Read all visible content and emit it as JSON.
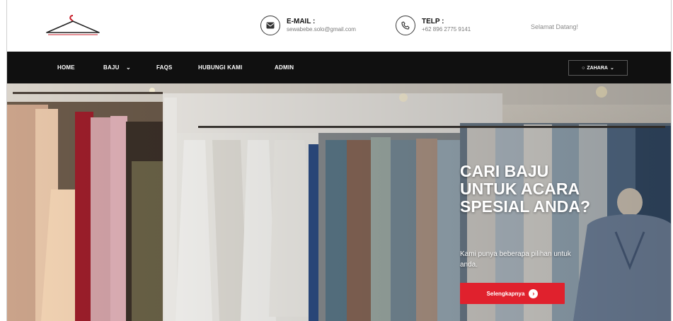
{
  "header": {
    "email_label": "E-MAIL :",
    "email_value": "sewabebe.solo@gmail.com",
    "phone_label": "TELP :",
    "phone_value": "+62 896 2775 9141",
    "welcome": "Selamat Datang!"
  },
  "nav": {
    "items": [
      "HOME",
      "BAJU",
      "FAQS",
      "HUBUNGI KAMI",
      "ADMIN"
    ],
    "user": "ZAHARA"
  },
  "hero": {
    "title_lines": [
      "CARI BAJU",
      "UNTUK ACARA",
      "SPESIAL ANDA?"
    ],
    "subtitle": "Kami punya beberapa pilihan untuk anda.",
    "button": "Selengkapnya"
  },
  "colors": {
    "nav_bg": "#101010",
    "accent": "#e0212d"
  },
  "icons": {
    "logo": "hanger-logo",
    "email": "envelope-icon",
    "phone": "phone-icon",
    "dropdown": "chevron-down-icon",
    "user": "user-icon",
    "button": "arrow-right-circle-icon"
  }
}
